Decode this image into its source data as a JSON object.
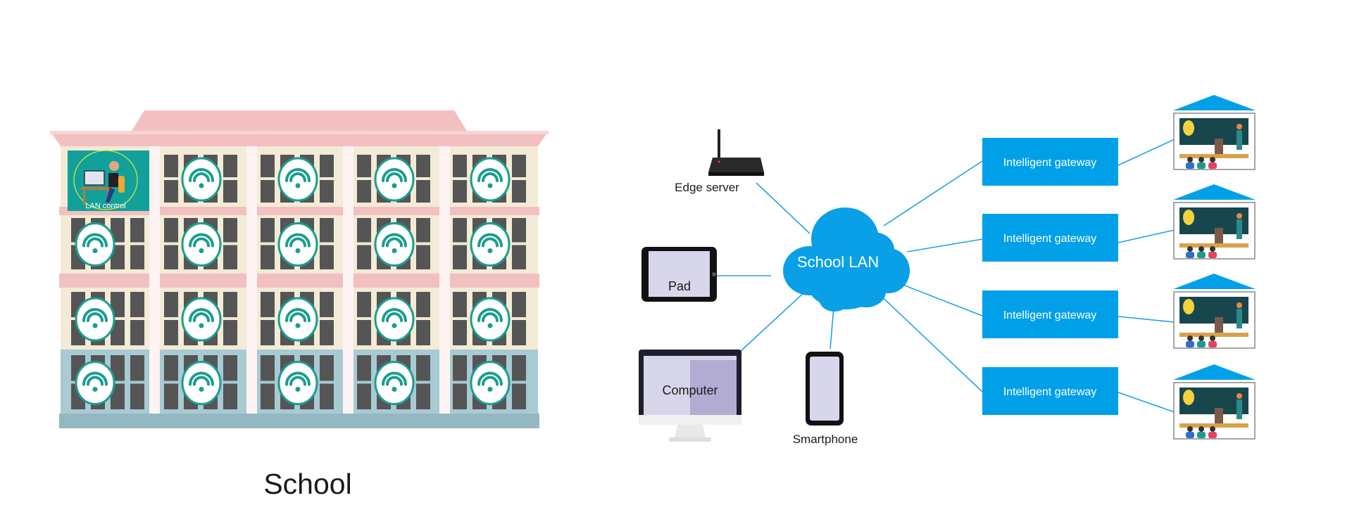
{
  "school": {
    "label": "School",
    "lan_control_label": "LAN control",
    "floors": 4,
    "bays": 5,
    "wifi_icon": "wifi-icon"
  },
  "network": {
    "cloud_label": "School  LAN",
    "edge_server_label": "Edge server",
    "pad_label": "Pad",
    "computer_label": "Computer",
    "smartphone_label": "Smartphone",
    "gateways": [
      {
        "label": "Intelligent gateway"
      },
      {
        "label": "Intelligent gateway"
      },
      {
        "label": "Intelligent gateway"
      },
      {
        "label": "Intelligent gateway"
      }
    ]
  },
  "colors": {
    "accent_blue": "#00a0e9",
    "wifi_teal": "#1a9e8f",
    "roof_pink": "#f2c0c0",
    "wall_cream": "#f3ebd6",
    "ground_blue": "#a8cad3",
    "window_dark": "#555555"
  }
}
